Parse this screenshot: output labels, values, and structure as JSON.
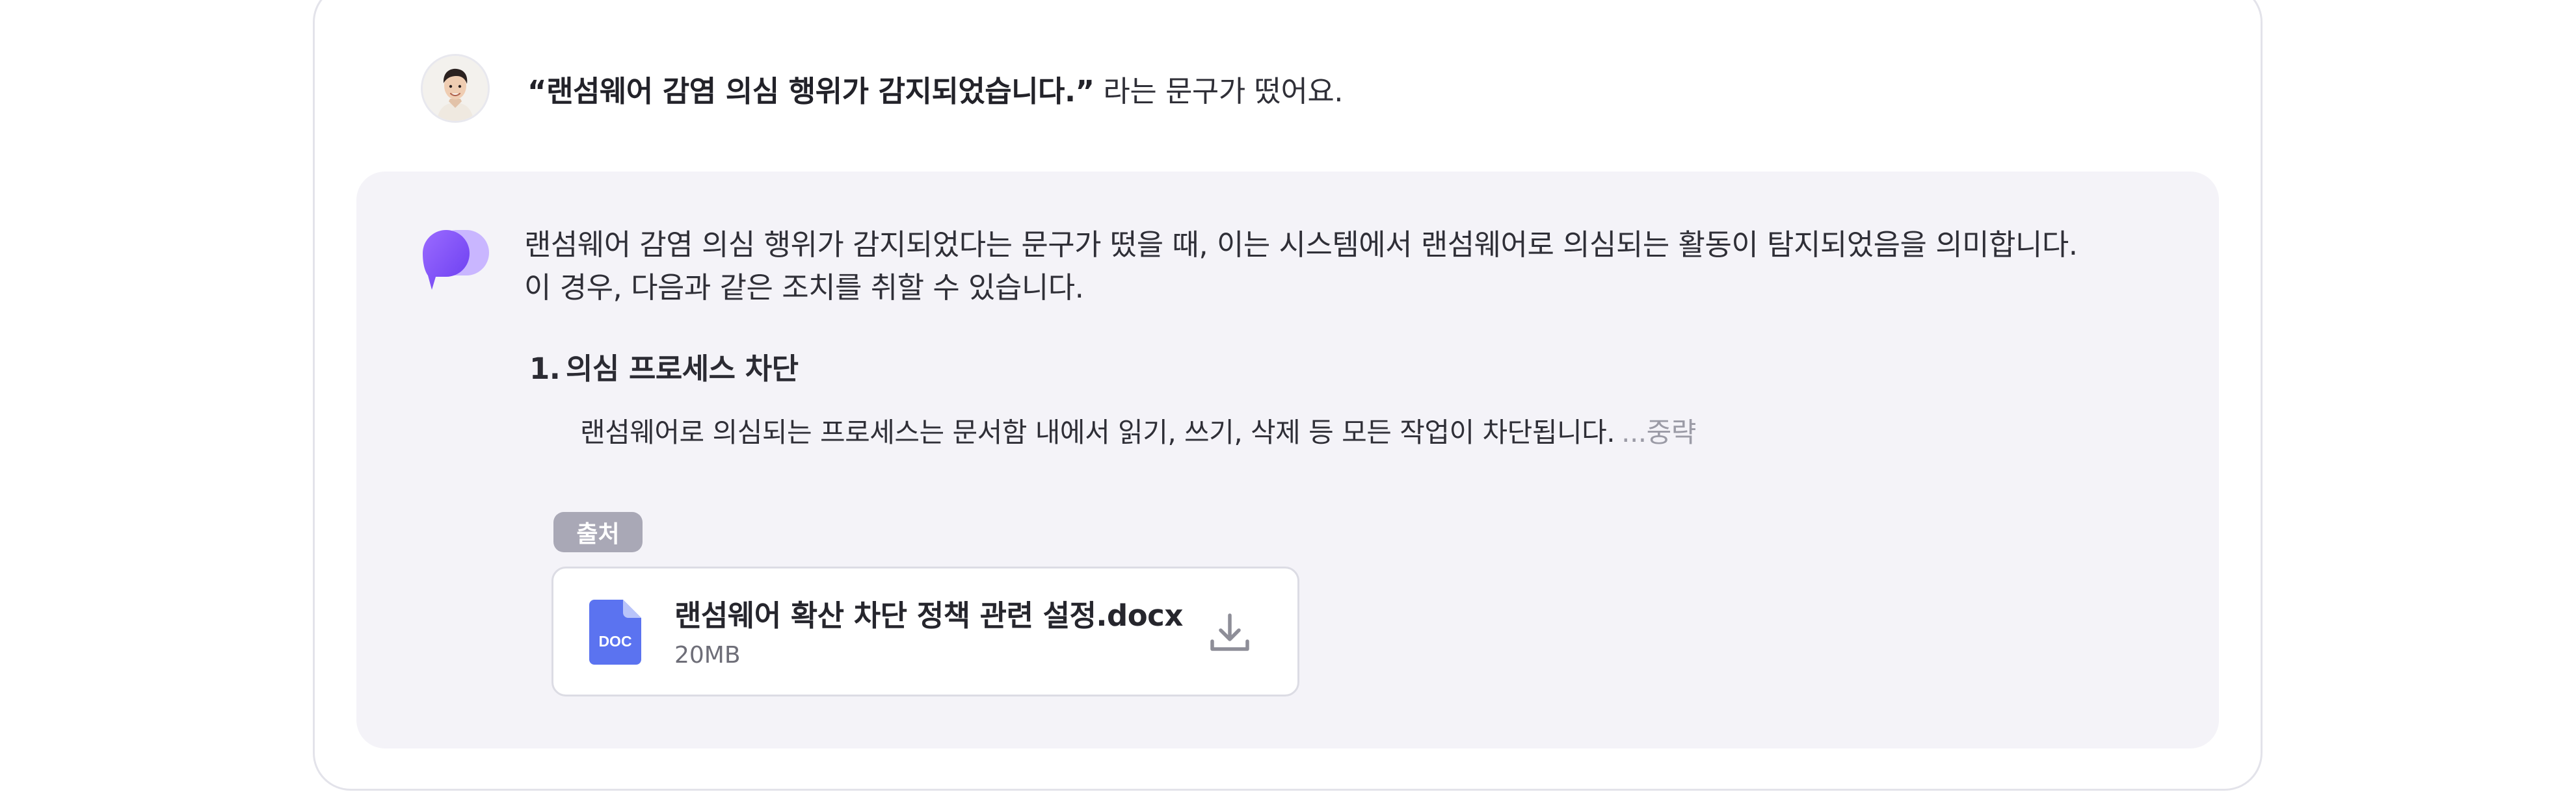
{
  "user_message": {
    "quote": "“랜섬웨어 감염 의심 행위가 감지되었습니다.”",
    "rest": " 라는 문구가 떴어요."
  },
  "assistant": {
    "intro_line1": "랜섬웨어 감염 의심 행위가 감지되었다는 문구가 떴을 때, 이는 시스템에서 랜섬웨어로 의심되는 활동이 탐지되었음을 의미합니다.",
    "intro_line2": "이 경우, 다음과 같은 조치를 취할 수 있습니다.",
    "steps": [
      {
        "number": "1.",
        "title": "의심 프로세스 차단",
        "description": "랜섬웨어로 의심되는 프로세스는 문서함 내에서 읽기, 쓰기, 삭제 등 모든 작업이 차단됩니다.",
        "more_label": "...중략"
      }
    ],
    "source_label": "출처",
    "attachment": {
      "file_name": "랜섬웨어 확산 차단 정책 관련 설정.docx",
      "file_size": "20MB",
      "type_badge": "DOC"
    }
  },
  "icons": {
    "avatar": "user-avatar",
    "assistant": "assistant-logo-icon",
    "document": "doc-file-icon",
    "download": "download-icon"
  },
  "colors": {
    "panel_bg": "#f4f3f8",
    "badge_bg": "#a9a8b6",
    "doc_icon": "#5b73f0",
    "assistant_purple": "#7c4dff",
    "muted_text": "#9b9ba6"
  }
}
